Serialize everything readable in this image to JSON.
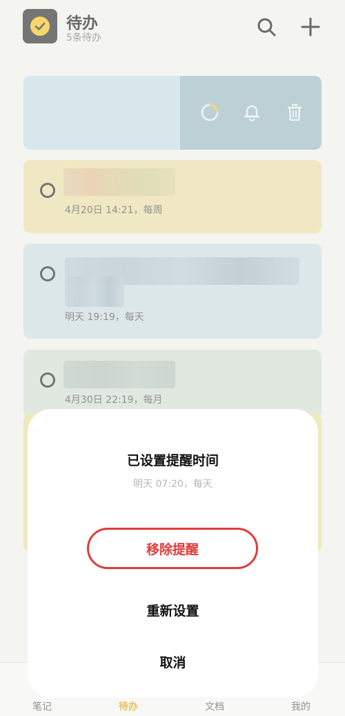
{
  "header": {
    "title": "待办",
    "subtitle": "5条待办"
  },
  "todos": [
    {
      "meta": "4月20日 14:21，每周"
    },
    {
      "meta": "明天 19:19，每天"
    },
    {
      "meta": "4月30日 22:19，每月"
    }
  ],
  "tabs": [
    {
      "label": "笔记"
    },
    {
      "label": "待办"
    },
    {
      "label": "文档"
    },
    {
      "label": "我的"
    }
  ],
  "sheet": {
    "title": "已设置提醒时间",
    "subtitle": "明天 07:20，每天",
    "remove_label": "移除提醒",
    "reset_label": "重新设置",
    "cancel_label": "取消"
  },
  "colors": {
    "accent": "#f2c21b",
    "danger": "#e23a3a",
    "active_tab": "#d4a400"
  }
}
